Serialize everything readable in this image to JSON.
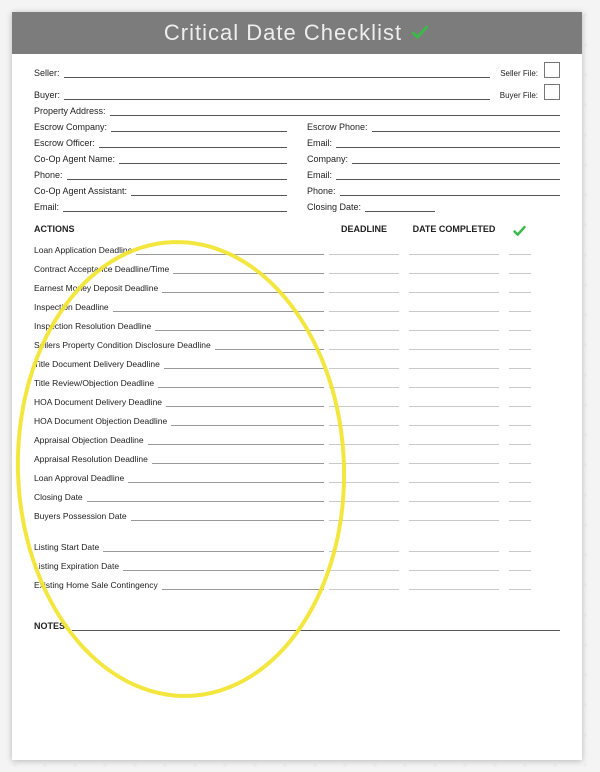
{
  "title": "Critical Date Checklist",
  "top_fields": {
    "seller": "Seller:",
    "seller_file": "Seller File:",
    "buyer": "Buyer:",
    "buyer_file": "Buyer File:",
    "property_address": "Property Address:"
  },
  "left_fields": [
    "Escrow Company:",
    "Escrow Officer:",
    "Co-Op Agent Name:",
    "Phone:",
    "Co-Op Agent Assistant:",
    "Email:"
  ],
  "right_fields": [
    "Escrow Phone:",
    "Email:",
    "Company:",
    "Email:",
    "Phone:",
    "Closing Date:"
  ],
  "headers": {
    "actions": "ACTIONS",
    "deadline": "DEADLINE",
    "completed": "DATE COMPLETED"
  },
  "actions_group1": [
    "Loan Application Deadline",
    "Contract Acceptance Deadline/Time",
    "Earnest Money Deposit Deadline",
    "Inspection Deadline",
    "Inspection Resolution Deadline",
    "Sellers Property Condition Disclosure Deadline",
    "Title Document Delivery Deadline",
    "Title Review/Objection Deadline",
    "HOA Document Delivery Deadline",
    "HOA Document Objection Deadline",
    "Appraisal Objection Deadline",
    "Appraisal Resolution Deadline",
    "Loan Approval Deadline",
    "Closing Date",
    "Buyers Possession Date"
  ],
  "actions_group2": [
    "Listing Start Date",
    "Listing Expiration Date",
    "Existing Home Sale Contingency"
  ],
  "notes": "NOTES:"
}
